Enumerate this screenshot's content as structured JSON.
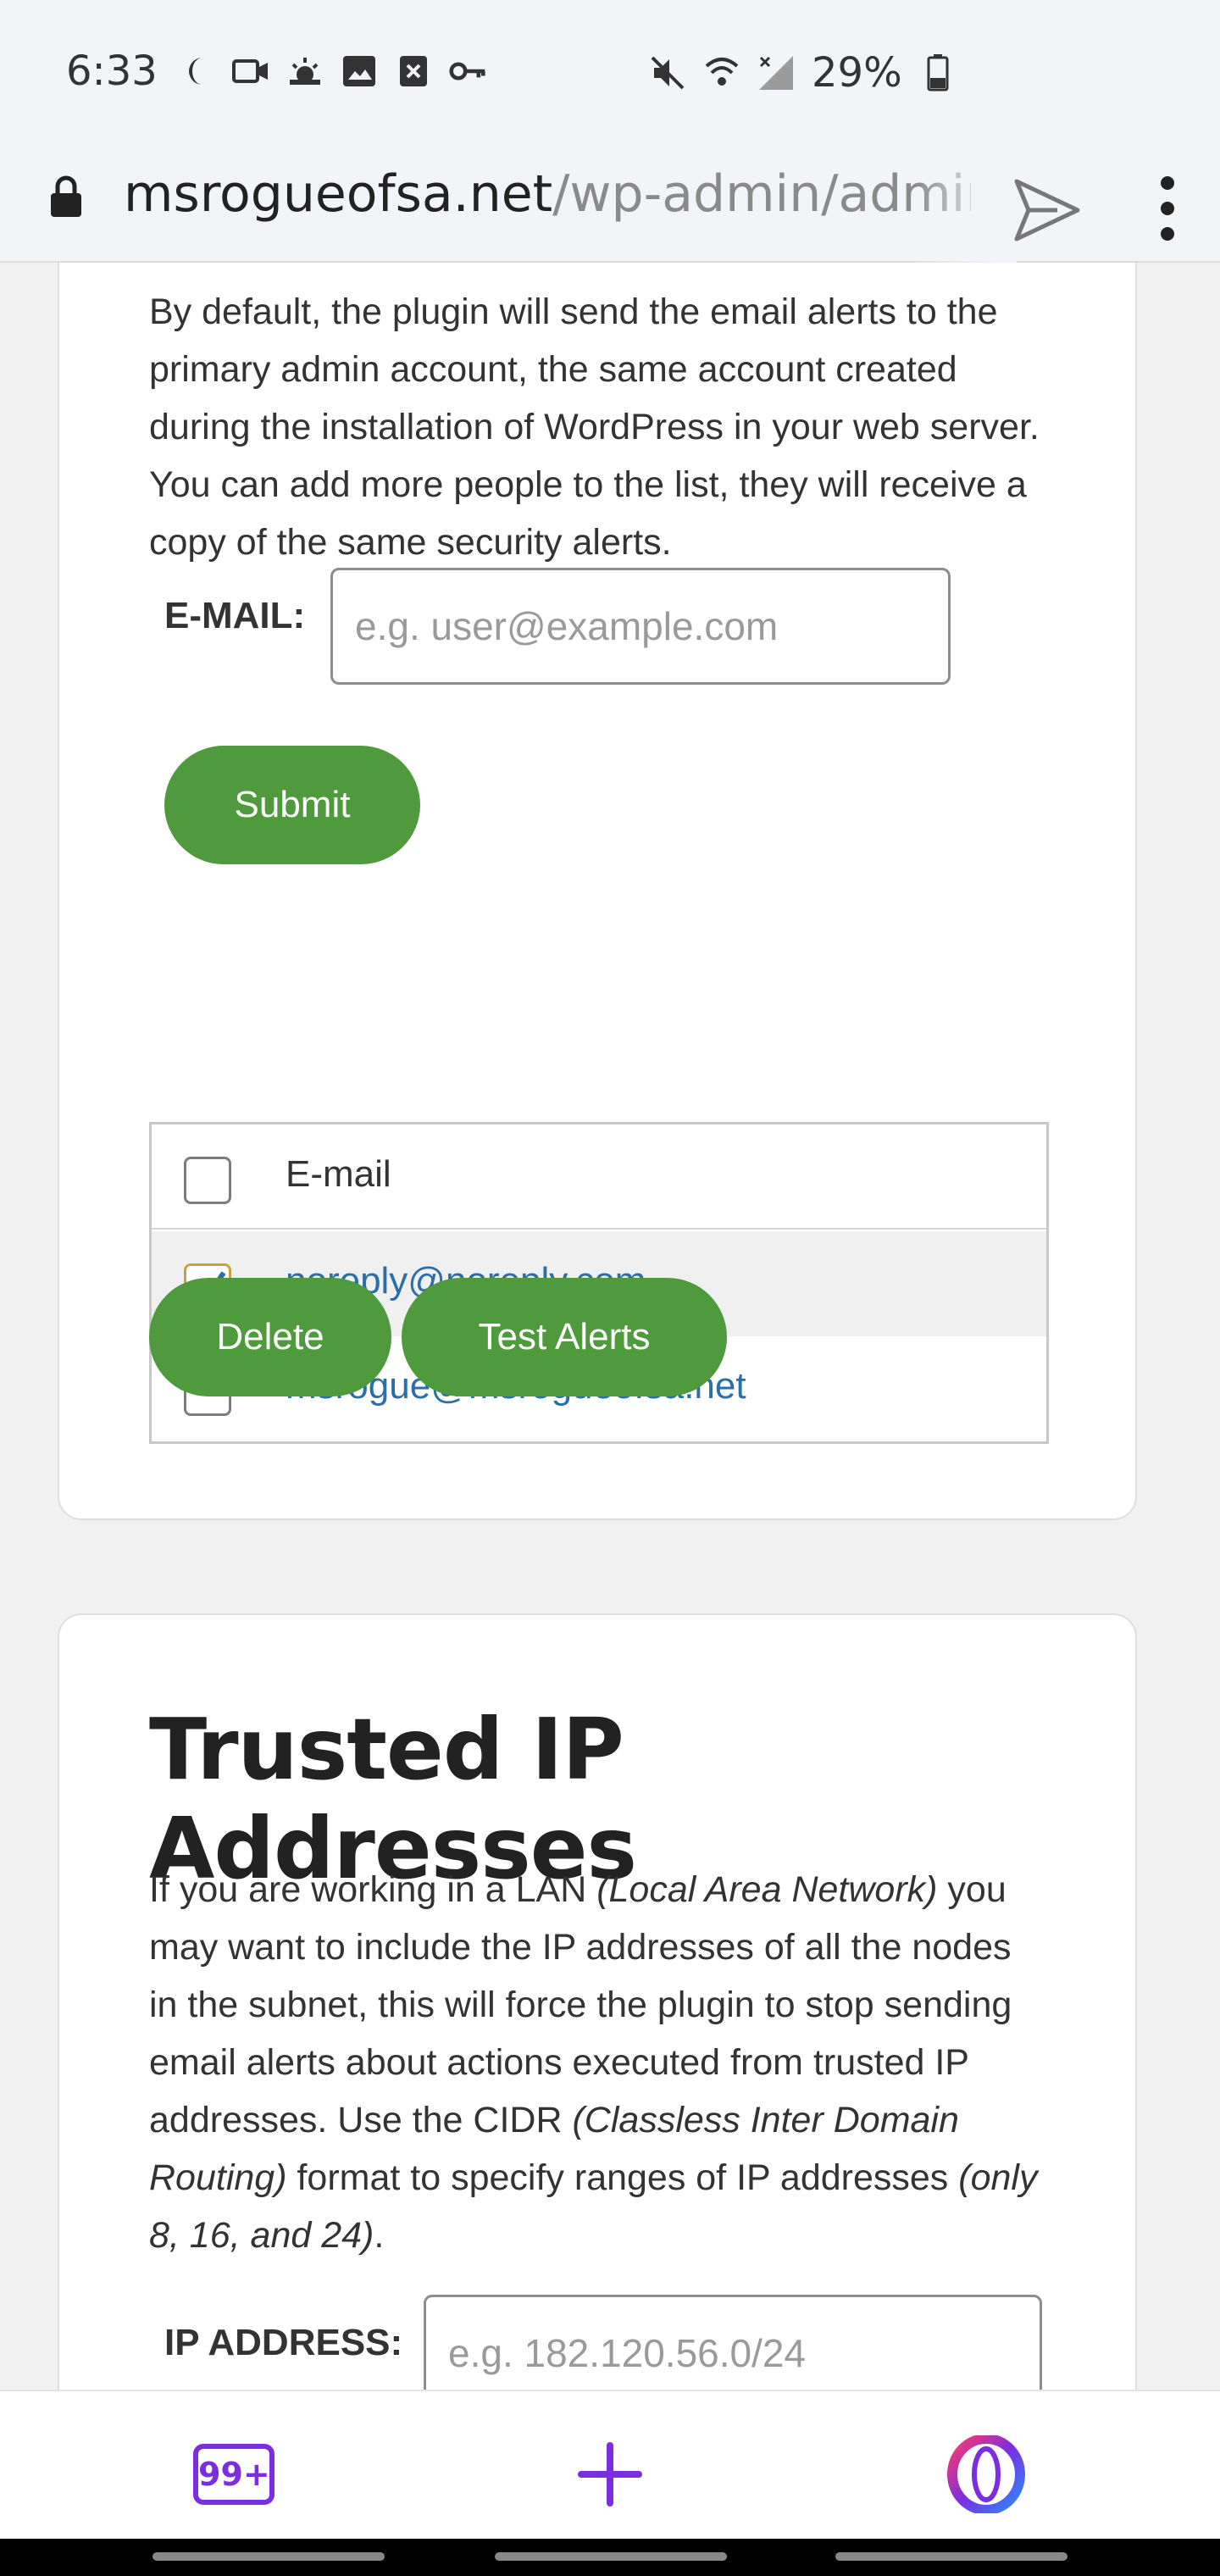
{
  "status_bar": {
    "time": "6:33",
    "battery": "29%"
  },
  "address_bar": {
    "host": "msrogueofsa.net",
    "path": "/wp-admin/admin.p"
  },
  "email_section": {
    "description": "By default, the plugin will send the email alerts to the primary admin account, the same account created during the installation of WordPress in your web server. You can add more people to the list, they will receive a copy of the same security alerts.",
    "email_label": "E-MAIL:",
    "email_placeholder": "e.g. user@example.com",
    "submit_label": "Submit",
    "table_header": "E-mail",
    "emails": [
      {
        "address": "noreply@noreply.com",
        "checked": true
      },
      {
        "address": "msrogue@msrogueofsa.net",
        "checked": false
      }
    ],
    "delete_label": "Delete",
    "test_alerts_label": "Test Alerts"
  },
  "trusted_ip_section": {
    "title": "Trusted IP Addresses",
    "desc_part1": "If you are working in a LAN ",
    "desc_em1": "(Local Area Network)",
    "desc_part2": " you may want to include the IP addresses of all the nodes in the subnet, this will force the plugin to stop sending email alerts about actions executed from trusted IP addresses. Use the CIDR ",
    "desc_em2": "(Classless Inter Domain Routing)",
    "desc_part3": " format to specify ranges of IP addresses ",
    "desc_em3": "(only 8, 16, and 24)",
    "desc_part4": ".",
    "ip_label": "IP ADDRESS:",
    "ip_placeholder": "e.g. 182.120.56.0/24"
  },
  "bottom_nav": {
    "tabs_count": "99+"
  },
  "colors": {
    "button_green": "#4e9a3d",
    "link_blue": "#2a6fa8",
    "opera_purple": "#7b2ee0"
  }
}
